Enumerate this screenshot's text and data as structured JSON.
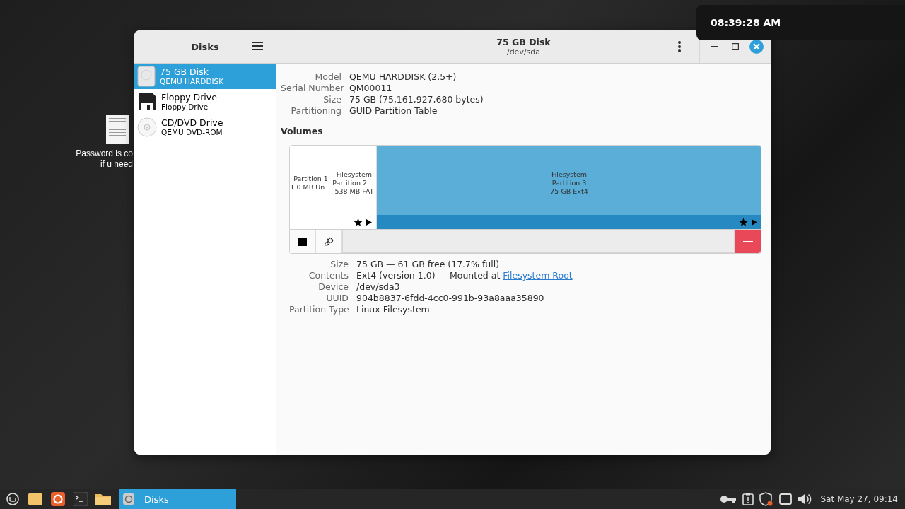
{
  "desktop_icon": {
    "lines": [
      "Password is co",
      "if u need"
    ]
  },
  "window": {
    "sidebar_title": "Disks",
    "title": "75 GB Disk",
    "subtitle": "/dev/sda"
  },
  "sidebar": {
    "items": [
      {
        "kind": "harddisk",
        "name": "75 GB Disk",
        "model": "QEMU HARDDISK",
        "selected": true
      },
      {
        "kind": "floppy",
        "name": "Floppy Drive",
        "model": "Floppy Drive",
        "selected": false
      },
      {
        "kind": "optical",
        "name": "CD/DVD Drive",
        "model": "QEMU DVD-ROM",
        "selected": false
      }
    ]
  },
  "disk_info": [
    {
      "label": "Model",
      "value": "QEMU HARDDISK (2.5+)"
    },
    {
      "label": "Serial Number",
      "value": "QM00011"
    },
    {
      "label": "Size",
      "value": "75 GB (75,161,927,680 bytes)"
    },
    {
      "label": "Partitioning",
      "value": "GUID Partition Table"
    }
  ],
  "volumes": {
    "heading": "Volumes",
    "partitions": [
      {
        "lines": [
          "Partition 1",
          "1.0 MB Un…"
        ],
        "mounted": false,
        "selected": false
      },
      {
        "lines": [
          "Filesystem",
          "Partition 2:…",
          "538 MB FAT"
        ],
        "mounted": true,
        "selected": false
      },
      {
        "lines": [
          "Filesystem",
          "Partition 3",
          "75 GB Ext4"
        ],
        "mounted": true,
        "selected": true
      }
    ]
  },
  "partition_info": [
    {
      "label": "Size",
      "value": "75 GB — 61 GB free (17.7% full)"
    },
    {
      "label": "Contents",
      "value": "Ext4 (version 1.0) — Mounted at ",
      "link": "Filesystem Root"
    },
    {
      "label": "Device",
      "value": "/dev/sda3"
    },
    {
      "label": "UUID",
      "value": "904b8837-6fdd-4cc0-991b-93a8aaa35890"
    },
    {
      "label": "Partition Type",
      "value": "Linux Filesystem"
    }
  ],
  "clock_popup": "08:39:28 AM",
  "taskbar": {
    "task": "Disks",
    "clock": "Sat May 27, 09:14"
  }
}
